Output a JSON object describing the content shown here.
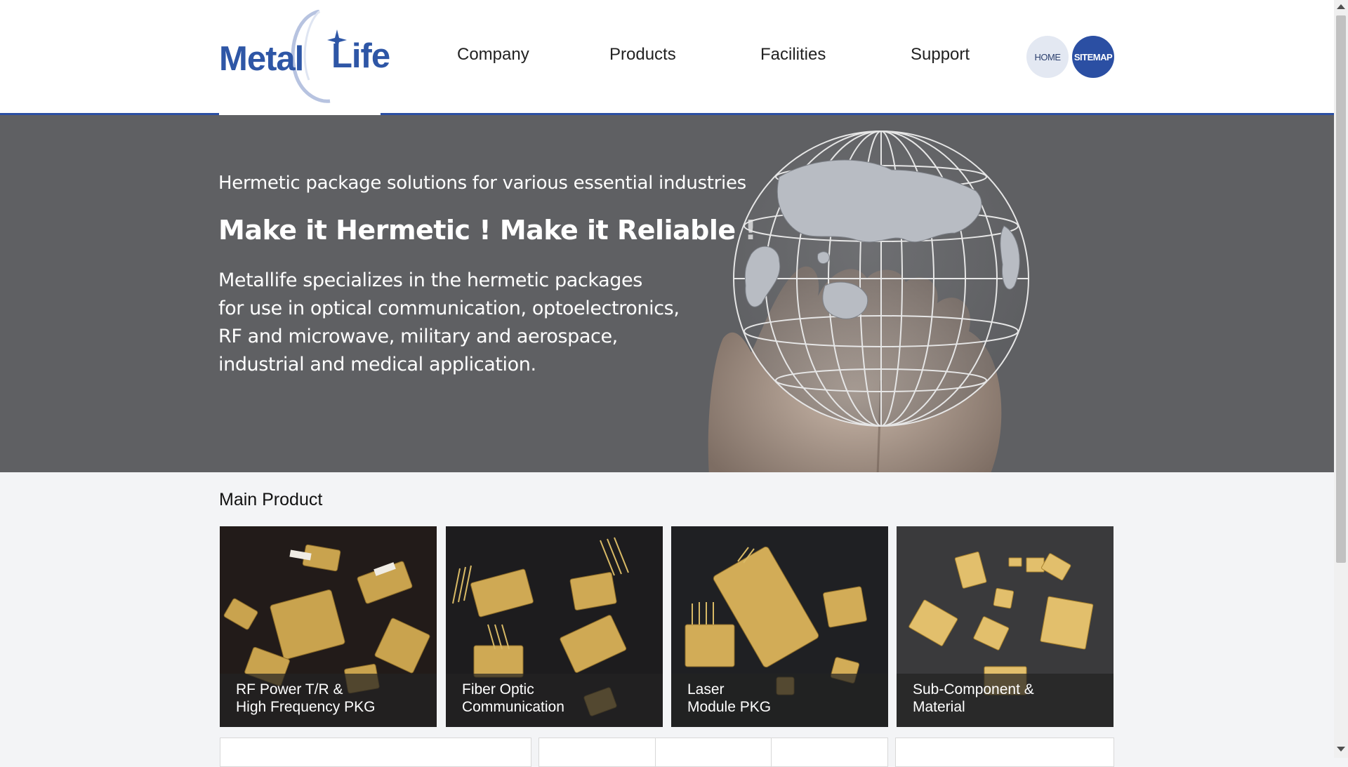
{
  "logo": {
    "word1": "Metal",
    "word2": "Life"
  },
  "nav": {
    "items": [
      {
        "label": "Company"
      },
      {
        "label": "Products"
      },
      {
        "label": "Facilities"
      },
      {
        "label": "Support"
      }
    ],
    "home_label": "HOME",
    "sitemap_label": "SITEMAP"
  },
  "hero": {
    "subtitle": "Hermetic package solutions for various essential industries",
    "title": "Make it Hermetic !   Make it Reliable !",
    "description_lines": [
      "Metallife specializes in the hermetic packages",
      "for use in optical communication, optoelectronics,",
      "RF and microwave, military and aerospace,",
      "industrial and medical application."
    ]
  },
  "main_product": {
    "heading": "Main Product",
    "cards": [
      {
        "line1": "RF Power T/R &",
        "line2": "High Frequency PKG"
      },
      {
        "line1": "Fiber Optic",
        "line2": "Communication"
      },
      {
        "line1": "Laser",
        "line2": "Module PKG"
      },
      {
        "line1": "Sub-Component &",
        "line2": "Material"
      }
    ]
  },
  "colors": {
    "brand_blue": "#2b4fa3",
    "hero_bg": "#5f6063",
    "page_bg": "#f3f4f6"
  }
}
